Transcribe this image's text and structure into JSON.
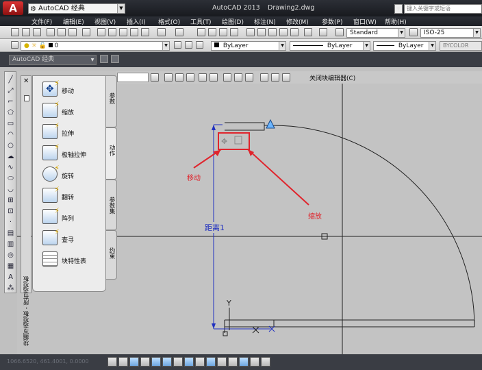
{
  "titlebar": {
    "logo_letter": "A",
    "workspace": "AutoCAD 经典",
    "app_title": "AutoCAD 2013",
    "doc_title": "Drawing2.dwg",
    "search_placeholder": "键入关键字或短语"
  },
  "menu": [
    "文件(F)",
    "编辑(E)",
    "视图(V)",
    "插入(I)",
    "格式(O)",
    "工具(T)",
    "绘图(D)",
    "标注(N)",
    "修改(M)",
    "参数(P)",
    "窗口(W)",
    "帮助(H)"
  ],
  "toolbar1": {
    "text_style": "Standard",
    "dim_style": "ISO-25"
  },
  "toolbar2": {
    "layer": "0",
    "color": "ByLayer",
    "linetype": "ByLayer",
    "lineweight": "ByLayer",
    "plot_style": "BYCOLOR"
  },
  "workspace_row": {
    "workspace": "AutoCAD 经典"
  },
  "block_editor": {
    "close_label": "关闭块编辑器(C)"
  },
  "palette": {
    "title": "块编写选项板 - 所有选项板",
    "items": [
      {
        "label": "移动",
        "icon": "move-action-icon"
      },
      {
        "label": "缩放",
        "icon": "scale-action-icon"
      },
      {
        "label": "拉伸",
        "icon": "stretch-action-icon"
      },
      {
        "label": "极轴拉伸",
        "icon": "polar-stretch-action-icon"
      },
      {
        "label": "旋转",
        "icon": "rotate-action-icon"
      },
      {
        "label": "翻转",
        "icon": "flip-action-icon"
      },
      {
        "label": "阵列",
        "icon": "array-action-icon"
      },
      {
        "label": "查寻",
        "icon": "lookup-action-icon"
      },
      {
        "label": "块特性表",
        "icon": "block-properties-table-icon"
      }
    ],
    "tabs": [
      "参数",
      "动作",
      "参数集",
      "约束"
    ],
    "active_tab": "动作"
  },
  "annotations": {
    "move_label": "移动",
    "scale_label": "缩放",
    "distance_label": "距离1",
    "y_axis_label": "Y"
  },
  "status": {
    "coordinates": "1066.6520, 461.4001, 0.0000"
  },
  "colors": {
    "title_bg": "#1e2026",
    "canvas_bg": "#c3c3c3",
    "annotation_red": "#e0242c",
    "dimension_blue": "#2030c0"
  }
}
